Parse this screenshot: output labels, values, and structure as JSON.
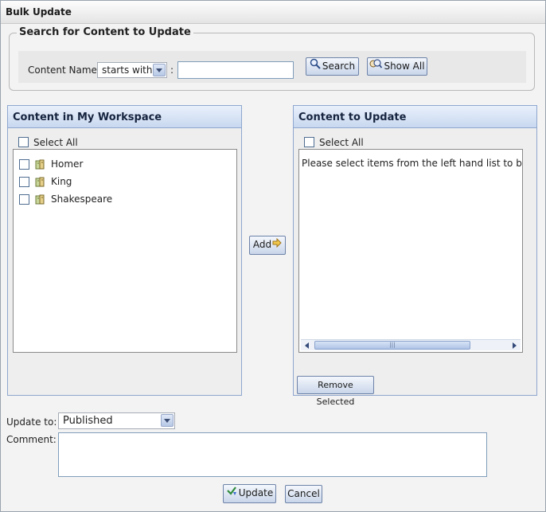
{
  "window": {
    "title": "Bulk Update"
  },
  "search": {
    "legend": "Search for Content to Update",
    "content_name_label": "Content Name",
    "match_mode": "starts with",
    "separator": ":",
    "query": "",
    "search_button": "Search",
    "show_all_button": "Show All"
  },
  "workspace": {
    "title": "Content in My Workspace",
    "select_all": "Select All",
    "items": [
      {
        "label": "Homer"
      },
      {
        "label": "King"
      },
      {
        "label": "Shakespeare"
      }
    ]
  },
  "add_button": "Add",
  "update_list": {
    "title": "Content to Update",
    "select_all": "Select All",
    "empty_message": "Please select items from the left hand list to bulk",
    "scroll_grip": "|||",
    "remove_button": "Remove Selected"
  },
  "form": {
    "update_to_label": "Update to:",
    "update_to_value": "Published",
    "comment_label": "Comment:",
    "comment_value": ""
  },
  "actions": {
    "update_button": "Update",
    "cancel_button": "Cancel"
  },
  "colors": {
    "panel_border": "#8ea7cf",
    "panel_header": "#c9d8f0",
    "button_border": "#6d82a8"
  }
}
